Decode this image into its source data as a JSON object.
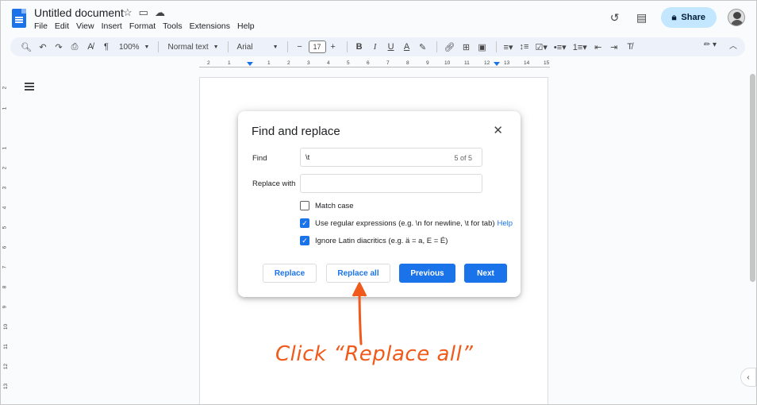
{
  "document": {
    "title": "Untitled document",
    "menu": [
      "File",
      "Edit",
      "View",
      "Insert",
      "Format",
      "Tools",
      "Extensions",
      "Help"
    ],
    "share_label": "Share"
  },
  "toolbar": {
    "zoom": "100%",
    "style": "Normal text",
    "font": "Arial",
    "font_size": "17",
    "bold": "B",
    "italic": "I",
    "underline": "U",
    "text_color": "A"
  },
  "ruler": {
    "numbers": [
      "2",
      "1",
      "1",
      "2",
      "3",
      "4",
      "5",
      "6",
      "7",
      "8",
      "9",
      "10",
      "11",
      "12",
      "13",
      "14",
      "15"
    ],
    "vertical_numbers": [
      "2",
      "1",
      "1",
      "2",
      "3",
      "4",
      "5",
      "6",
      "7",
      "8",
      "9",
      "10",
      "11",
      "12",
      "13"
    ]
  },
  "dialog": {
    "title": "Find and replace",
    "find_label": "Find",
    "find_value": "\\t",
    "match_count": "5 of 5",
    "replace_label": "Replace with",
    "replace_value": "",
    "options": {
      "match_case": {
        "label": "Match case",
        "checked": false
      },
      "regex": {
        "label": "Use regular expressions (e.g. \\n for newline, \\t for tab)",
        "help": "Help",
        "checked": true
      },
      "diacritics": {
        "label": "Ignore Latin diacritics (e.g. ä = a, E = É)",
        "checked": true
      }
    },
    "buttons": {
      "replace": "Replace",
      "replace_all": "Replace all",
      "previous": "Previous",
      "next": "Next"
    }
  },
  "annotation": {
    "text": "Click “Replace all”",
    "color": "#f05a1a"
  },
  "colors": {
    "accent": "#1a73e8",
    "share_bg": "#c2e7ff",
    "toolbar_bg": "#edf2fa"
  }
}
